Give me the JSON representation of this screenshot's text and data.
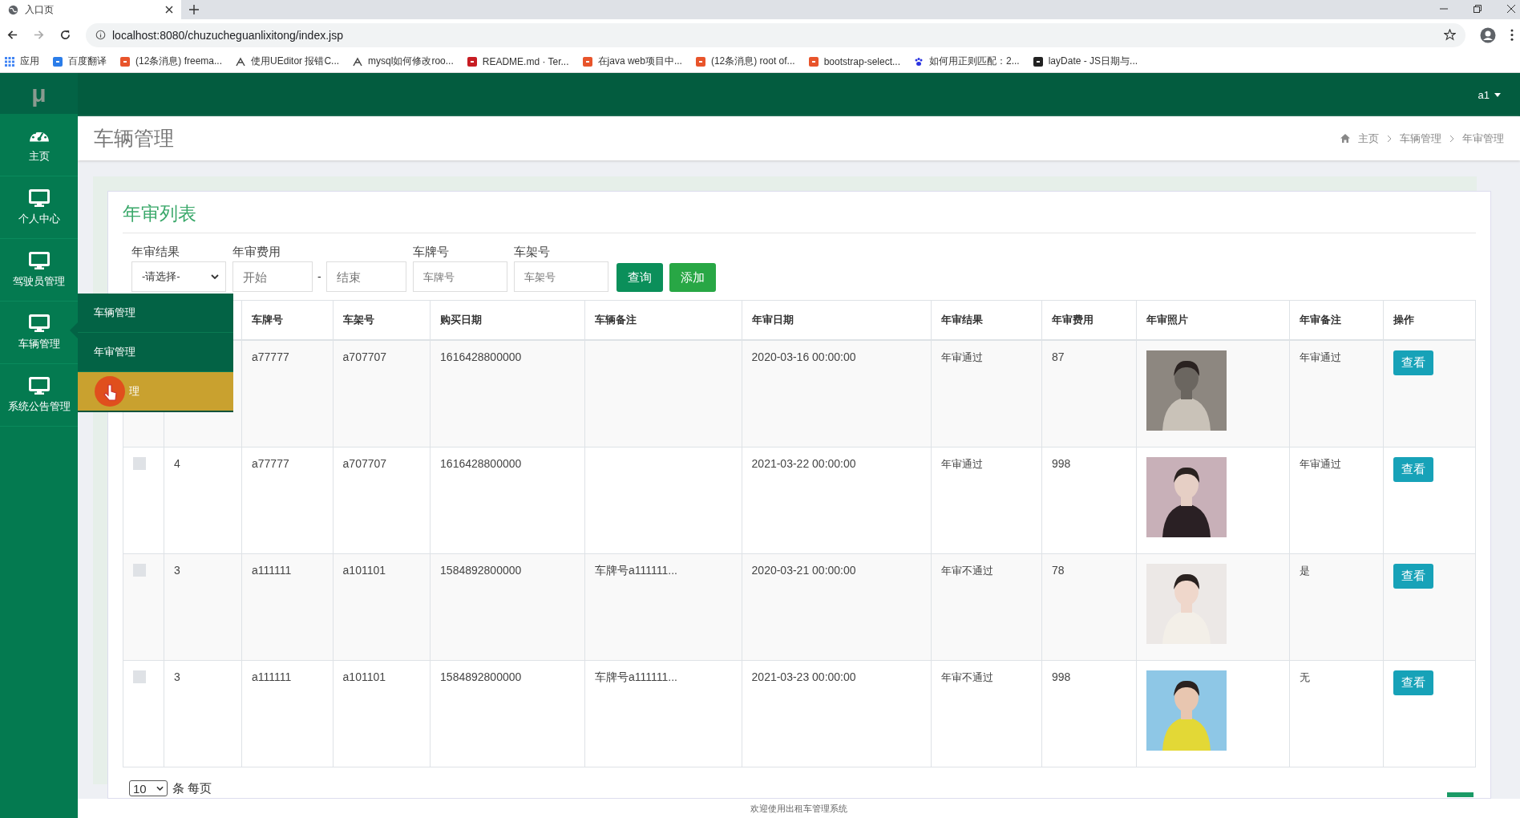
{
  "browser": {
    "tab_title": "入口页",
    "url": "localhost:8080/chuzucheguanlixitong/index.jsp",
    "bookmarks": [
      {
        "label": "应用",
        "kind": "apps"
      },
      {
        "label": "百度翻译",
        "kind": "translate"
      },
      {
        "label": "(12条消息) freema...",
        "kind": "csdn"
      },
      {
        "label": "使用UEditor 报错C...",
        "kind": "tool"
      },
      {
        "label": "mysql如何修改roo...",
        "kind": "tool"
      },
      {
        "label": "README.md · Ter...",
        "kind": "gitee"
      },
      {
        "label": "在java web项目中...",
        "kind": "csdn"
      },
      {
        "label": "(12条消息) root of...",
        "kind": "csdn"
      },
      {
        "label": "bootstrap-select...",
        "kind": "jian"
      },
      {
        "label": "如何用正则匹配：2...",
        "kind": "baidu"
      },
      {
        "label": "layDate - JS日期与...",
        "kind": "layui"
      }
    ]
  },
  "app": {
    "logo": "μ",
    "user": "a1"
  },
  "sidebar": {
    "items": [
      {
        "label": "主页",
        "expanded": false
      },
      {
        "label": "个人中心",
        "expanded": false
      },
      {
        "label": "驾驶员管理",
        "expanded": false
      },
      {
        "label": "车辆管理",
        "expanded": true
      },
      {
        "label": "系统公告管理",
        "expanded": false
      }
    ],
    "submenu": [
      {
        "label": "车辆管理",
        "selected": false
      },
      {
        "label": "年审管理",
        "selected": false
      },
      {
        "label": "理",
        "selected": true
      }
    ]
  },
  "page_title": "车辆管理",
  "breadcrumb": [
    "主页",
    "车辆管理",
    "年审管理"
  ],
  "card": {
    "title": "年审列表",
    "filters": {
      "result": {
        "label": "年审结果",
        "value": "-请选择-"
      },
      "fee": {
        "label": "年审费用",
        "from_placeholder": "开始",
        "separator": "-",
        "to_placeholder": "结束"
      },
      "plate": {
        "label": "车牌号",
        "placeholder": "车牌号"
      },
      "frame": {
        "label": "车架号",
        "placeholder": "车架号"
      },
      "buttons": [
        "查询",
        "添加"
      ]
    },
    "table": {
      "columns": [
        "车牌号",
        "车架号",
        "购买日期",
        "车辆备注",
        "年审日期",
        "年审结果",
        "年审费用",
        "年审照片",
        "年审备注",
        "操作"
      ],
      "rows": [
        {
          "plate": "a77777",
          "frame": "a707707",
          "buy_date": "1616428800000",
          "note": "",
          "date": "2020-03-16 00:00:00",
          "result": "年审通过",
          "fee": "87",
          "remark": "年审通过",
          "action": "查看"
        },
        {
          "checked": false,
          "id": "4",
          "plate": "a77777",
          "frame": "a707707",
          "buy_date": "1616428800000",
          "note": "",
          "date": "2021-03-22 00:00:00",
          "result": "年审通过",
          "fee": "998",
          "remark": "年审通过",
          "action": "查看"
        },
        {
          "checked": false,
          "id": "3",
          "plate": "a111111",
          "frame": "a101101",
          "buy_date": "1584892800000",
          "note": "车牌号a111111...",
          "date": "2020-03-21 00:00:00",
          "result": "年审不通过",
          "fee": "78",
          "remark": "是",
          "action": "查看"
        },
        {
          "checked": false,
          "id": "3",
          "plate": "a111111",
          "frame": "a101101",
          "buy_date": "1584892800000",
          "note": "车牌号a111111...",
          "date": "2021-03-23 00:00:00",
          "result": "年审不通过",
          "fee": "998",
          "remark": "无",
          "action": "查看"
        }
      ]
    },
    "page_size": "10",
    "page_size_label": "条 每页"
  },
  "footer": "欢迎使用出租车管理系统"
}
